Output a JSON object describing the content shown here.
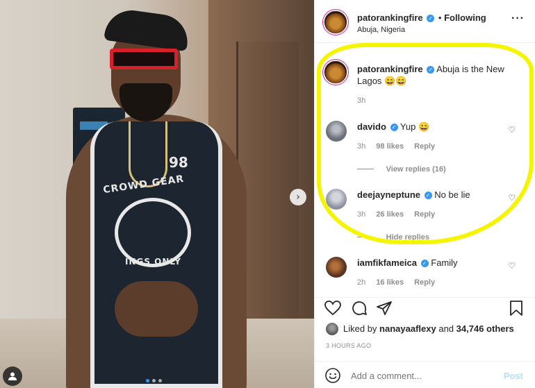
{
  "post": {
    "author": "patorankingfire",
    "follow_separator": "•",
    "follow_state": "Following",
    "location": "Abuja, Nigeria",
    "more_icon": "ellipsis-icon"
  },
  "caption": {
    "author": "patorankingfire",
    "text": "Abuja is the New Lagos 😄😄",
    "time": "3h"
  },
  "comments": [
    {
      "user": "davido",
      "text": "Yup 😄",
      "time": "3h",
      "likes": "98 likes",
      "reply": "Reply"
    },
    {
      "user": "deejayneptune",
      "text": "No be lie",
      "time": "3h",
      "likes": "26 likes",
      "reply": "Reply"
    },
    {
      "user": "iamfikfameica",
      "text": "Family",
      "time": "2h",
      "likes": "16 likes",
      "reply": "Reply"
    }
  ],
  "thread": {
    "view_replies": "View replies (16)",
    "hide_replies": "Hide replies"
  },
  "photo": {
    "jersey_number": "98",
    "jersey_line1": "CROWD GEAR",
    "jersey_line2": "INGS ONLY",
    "carousel_count": 3,
    "carousel_active": 1
  },
  "likes": {
    "prefix": "Liked by",
    "user": "nanayaaflexy",
    "conjunction": "and",
    "others": "34,746 others"
  },
  "posted_time": "3 HOURS AGO",
  "comment_input": {
    "placeholder": "Add a comment...",
    "post_label": "Post"
  },
  "colors": {
    "highlight": "#f5f500",
    "verified": "#3897f0",
    "post_disabled": "#b2dffc"
  }
}
